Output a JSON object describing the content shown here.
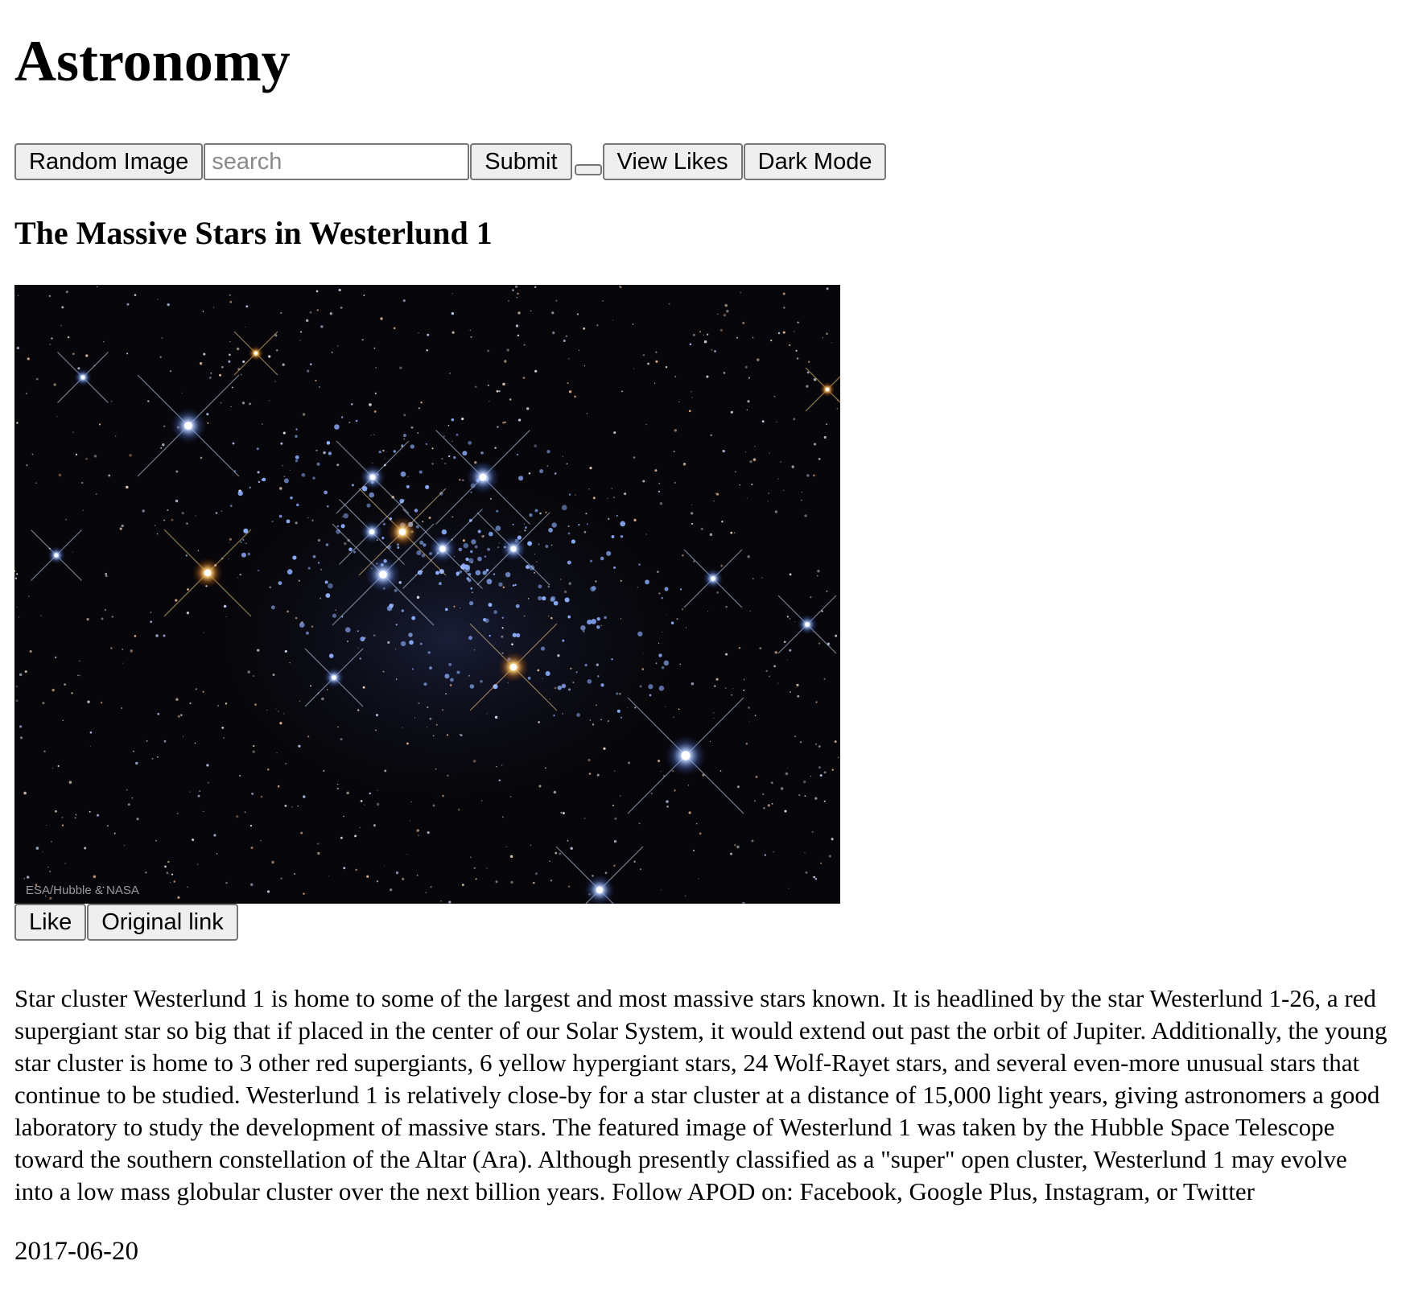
{
  "app": {
    "title": "Astronomy"
  },
  "toolbar": {
    "random_label": "Random Image",
    "search_placeholder": "search",
    "submit_label": "Submit",
    "view_likes_label": "View Likes",
    "dark_mode_label": "Dark Mode"
  },
  "apod": {
    "title": "The Massive Stars in Westerlund 1",
    "image_credit": "ESA/Hubble & NASA",
    "like_label": "Like",
    "original_link_label": "Original link",
    "explanation": "Star cluster Westerlund 1 is home to some of the largest and most massive stars known. It is headlined by the star Westerlund 1-26, a red supergiant star so big that if placed in the center of our Solar System, it would extend out past the orbit of Jupiter. Additionally, the young star cluster is home to 3 other red supergiants, 6 yellow hypergiant stars, 24 Wolf-Rayet stars, and several even-more unusual stars that continue to be studied. Westerlund 1 is relatively close-by for a star cluster at a distance of 15,000 light years, giving astronomers a good laboratory to study the development of massive stars. The featured image of Westerlund 1 was taken by the Hubble Space Telescope toward the southern constellation of the Altar (Ara). Although presently classified as a \"super\" open cluster, Westerlund 1 may evolve into a low mass globular cluster over the next billion years. Follow APOD on: Facebook, Google Plus, Instagram, or Twitter",
    "date": "2017-06-20"
  },
  "colors": {
    "button_bg": "#efefef",
    "button_border": "#767676",
    "image_bg": "#07060a"
  }
}
